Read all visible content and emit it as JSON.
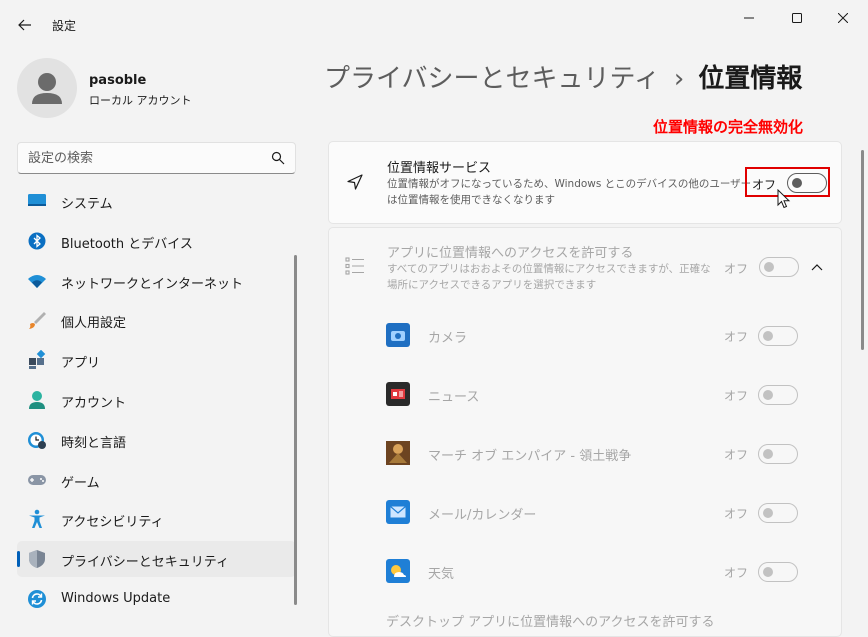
{
  "window": {
    "title": "設定"
  },
  "profile": {
    "name": "pasoble",
    "account_type": "ローカル アカウント"
  },
  "search": {
    "placeholder": "設定の検索"
  },
  "nav": {
    "items": [
      {
        "label": "システム",
        "icon": "system-icon"
      },
      {
        "label": "Bluetooth とデバイス",
        "icon": "bluetooth-icon"
      },
      {
        "label": "ネットワークとインターネット",
        "icon": "wifi-icon"
      },
      {
        "label": "個人用設定",
        "icon": "brush-icon"
      },
      {
        "label": "アプリ",
        "icon": "apps-icon"
      },
      {
        "label": "アカウント",
        "icon": "account-icon"
      },
      {
        "label": "時刻と言語",
        "icon": "time-language-icon"
      },
      {
        "label": "ゲーム",
        "icon": "gamepad-icon"
      },
      {
        "label": "アクセシビリティ",
        "icon": "accessibility-icon"
      },
      {
        "label": "プライバシーとセキュリティ",
        "icon": "shield-icon",
        "selected": true
      },
      {
        "label": "Windows Update",
        "icon": "update-icon"
      }
    ]
  },
  "breadcrumb": {
    "parent": "プライバシーとセキュリティ",
    "separator": "›",
    "current": "位置情報"
  },
  "annotation": {
    "text": "位置情報の完全無効化",
    "color": "#ff0000"
  },
  "location_service": {
    "title": "位置情報サービス",
    "description_line1": "位置情報がオフになっているため、Windows とこのデバイスの他のユーザー",
    "description_line2": "は位置情報を使用できなくなります",
    "state_label": "オフ",
    "enabled": false
  },
  "app_access": {
    "title": "アプリに位置情報へのアクセスを許可する",
    "description_line1": "すべてのアプリはおおよその位置情報にアクセスできますが、正確な",
    "description_line2": "場所にアクセスできるアプリを選択できます",
    "state_label": "オフ",
    "enabled": false
  },
  "apps": [
    {
      "name": "カメラ",
      "state": "オフ",
      "icon": "camera-app-icon"
    },
    {
      "name": "ニュース",
      "state": "オフ",
      "icon": "news-app-icon"
    },
    {
      "name": "マーチ オブ エンパイア - 領土戦争",
      "state": "オフ",
      "icon": "game-app-icon"
    },
    {
      "name": "メール/カレンダー",
      "state": "オフ",
      "icon": "mail-app-icon"
    },
    {
      "name": "天気",
      "state": "オフ",
      "icon": "weather-app-icon"
    }
  ],
  "desktop_access": {
    "title": "デスクトップ アプリに位置情報へのアクセスを許可する"
  },
  "colors": {
    "accent": "#005fb8",
    "background": "#f3f3f3",
    "card": "#fbfbfb",
    "highlight": "#e00000"
  }
}
